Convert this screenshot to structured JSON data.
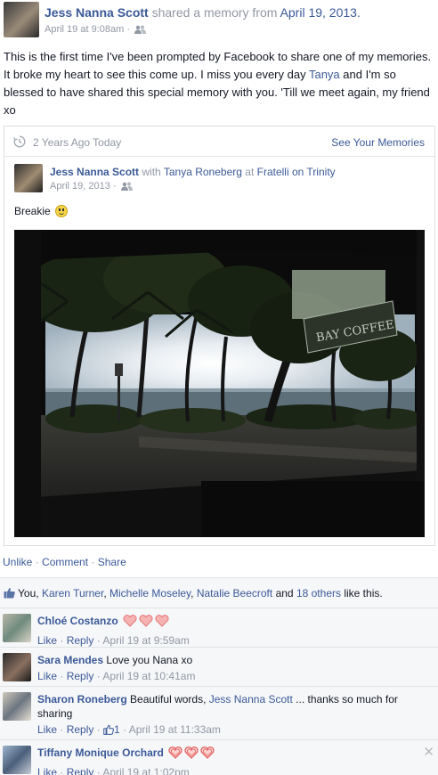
{
  "post": {
    "author": "Jess Nanna Scott",
    "verb": "shared a memory from",
    "memory_date": "April 19, 2013.",
    "timestamp": "April 19 at 9:08am",
    "audience_sep": "·",
    "text_before_tag": "This is the first time I've been prompted by Facebook to share one of my memories. It broke my heart to see this come up. I miss you every day ",
    "tag": "Tanya",
    "text_after_tag": " and I'm so blessed to have shared this special memory with you. 'Till we meet again, my friend xo"
  },
  "memory": {
    "ago": "2 Years Ago Today",
    "see_link": "See Your Memories",
    "author": "Jess Nanna Scott",
    "with_word": "with",
    "with_person": "Tanya Roneberg",
    "at_word": "at",
    "place": "Fratelli on Trinity",
    "date": "April 19, 2013",
    "date_sep": "·",
    "caption": "Breakie",
    "photo_sign": "BAY COFFEE"
  },
  "actions": {
    "unlike": "Unlike",
    "comment": "Comment",
    "share": "Share",
    "sep": "·"
  },
  "likes": {
    "you": "You",
    "names": [
      "Karen Turner",
      "Michelle Moseley",
      "Natalie Beecroft"
    ],
    "comma": ",",
    "and_word": "and",
    "others": "18 others",
    "tail": "like this."
  },
  "comments": [
    {
      "name": "Chloé Costanzo",
      "text": "",
      "like": "Like",
      "reply": "Reply",
      "time": "April 19 at 9:59am",
      "hearts": 3
    },
    {
      "name": "Sara Mendes",
      "text": "Love you Nana xo",
      "like": "Like",
      "reply": "Reply",
      "time": "April 19 at 10:41am",
      "hearts": 0
    },
    {
      "name": "Sharon Roneberg",
      "text_before": "Beautiful words, ",
      "mention": "Jess Nanna Scott",
      "text_after": " ... thanks so much for sharing",
      "like": "Like",
      "reply": "Reply",
      "like_count": "1",
      "time": "April 19 at 11:33am",
      "hearts": 0
    },
    {
      "name": "Tiffany Monique Orchard",
      "text": "",
      "like": "Like",
      "reply": "Reply",
      "time": "April 19 at 1:02pm",
      "hearts": 3
    }
  ],
  "icons": {
    "friends": "friends-icon",
    "clock": "clock-icon",
    "like": "thumbs-up-icon",
    "heart": "heart-icon",
    "close": "close-icon"
  },
  "colors": {
    "link": "#3b5998",
    "muted": "#9197a3",
    "heart_fill": "#f4a3a3",
    "heart_stroke": "#e05a5a"
  },
  "close_glyph": "✕"
}
